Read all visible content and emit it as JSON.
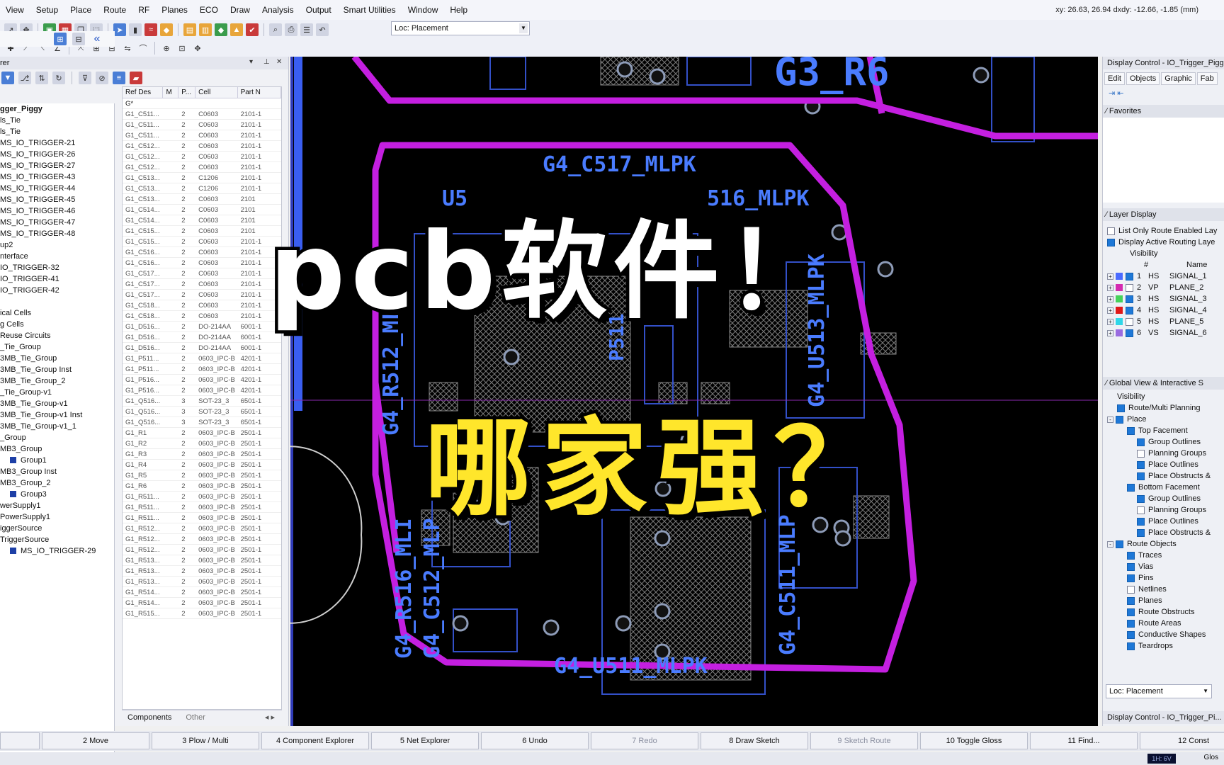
{
  "menu": [
    "View",
    "Setup",
    "Place",
    "Route",
    "RF",
    "Planes",
    "ECO",
    "Draw",
    "Analysis",
    "Output",
    "Smart Utilities",
    "Window",
    "Help"
  ],
  "coords": "xy: 26.63, 26.94  dxdy: -12.66, -1.85  (mm)",
  "toolbar": {
    "loc_label": "Loc: Placement"
  },
  "explorer": {
    "title": "rer",
    "tree": [
      {
        "label": "gger_Piggy",
        "bold": true,
        "icon": false
      },
      {
        "label": "ls_Tie",
        "icon": false
      },
      {
        "label": "ls_Tie",
        "icon": false
      },
      {
        "label": "MS_IO_TRIGGER-21",
        "icon": false
      },
      {
        "label": "MS_IO_TRIGGER-26",
        "icon": false
      },
      {
        "label": "MS_IO_TRIGGER-27",
        "icon": false
      },
      {
        "label": "MS_IO_TRIGGER-43",
        "icon": false
      },
      {
        "label": "MS_IO_TRIGGER-44",
        "icon": false
      },
      {
        "label": "MS_IO_TRIGGER-45",
        "icon": false
      },
      {
        "label": "MS_IO_TRIGGER-46",
        "icon": false
      },
      {
        "label": "MS_IO_TRIGGER-47",
        "icon": false
      },
      {
        "label": "MS_IO_TRIGGER-48",
        "icon": false
      },
      {
        "label": "up2",
        "icon": false
      },
      {
        "label": "nterface",
        "icon": false
      },
      {
        "label": "IO_TRIGGER-32",
        "icon": false
      },
      {
        "label": "IO_TRIGGER-41",
        "icon": false
      },
      {
        "label": "IO_TRIGGER-42",
        "icon": false
      },
      {
        "label": "",
        "icon": false
      },
      {
        "label": "ical Cells",
        "icon": false
      },
      {
        "label": "g Cells",
        "icon": false
      },
      {
        "label": "Reuse Circuits",
        "icon": false
      },
      {
        "label": "_Tie_Group",
        "icon": false
      },
      {
        "label": "3MB_Tie_Group",
        "icon": false
      },
      {
        "label": "3MB_Tie_Group Inst",
        "icon": false
      },
      {
        "label": "3MB_Tie_Group_2",
        "icon": false
      },
      {
        "label": "_Tie_Group-v1",
        "icon": false
      },
      {
        "label": "3MB_Tie_Group-v1",
        "icon": false
      },
      {
        "label": "3MB_Tie_Group-v1 Inst",
        "icon": false
      },
      {
        "label": "3MB_Tie_Group-v1_1",
        "icon": false
      },
      {
        "label": "_Group",
        "icon": false
      },
      {
        "label": "MB3_Group",
        "icon": false
      },
      {
        "label": "Group1",
        "icon": true
      },
      {
        "label": "MB3_Group Inst",
        "icon": false
      },
      {
        "label": "MB3_Group_2",
        "icon": false
      },
      {
        "label": "Group3",
        "icon": true
      },
      {
        "label": "werSupply1",
        "icon": false
      },
      {
        "label": "PowerSupply1",
        "icon": false
      },
      {
        "label": "iggerSource",
        "icon": false
      },
      {
        "label": "TriggerSource",
        "icon": false
      },
      {
        "label": "MS_IO_TRIGGER-29",
        "icon": true
      }
    ],
    "columns": [
      "Ref Des",
      "M",
      "P...",
      "Cell",
      "Part N"
    ],
    "filter": "G*",
    "rows": [
      [
        "G1_C511...",
        "",
        "2",
        "C0603",
        "2101-1"
      ],
      [
        "G1_C511...",
        "",
        "2",
        "C0603",
        "2101-1"
      ],
      [
        "G1_C511...",
        "",
        "2",
        "C0603",
        "2101-1"
      ],
      [
        "G1_C512...",
        "",
        "2",
        "C0603",
        "2101-1"
      ],
      [
        "G1_C512...",
        "",
        "2",
        "C0603",
        "2101-1"
      ],
      [
        "G1_C512...",
        "",
        "2",
        "C0603",
        "2101-1"
      ],
      [
        "G1_C513...",
        "",
        "2",
        "C1206",
        "2101-1"
      ],
      [
        "G1_C513...",
        "",
        "2",
        "C1206",
        "2101-1"
      ],
      [
        "G1_C513...",
        "",
        "2",
        "C0603",
        "2101"
      ],
      [
        "G1_C514...",
        "",
        "2",
        "C0603",
        "2101"
      ],
      [
        "G1_C514...",
        "",
        "2",
        "C0603",
        "2101"
      ],
      [
        "G1_C515...",
        "",
        "2",
        "C0603",
        "2101"
      ],
      [
        "G1_C515...",
        "",
        "2",
        "C0603",
        "2101-1"
      ],
      [
        "G1_C516...",
        "",
        "2",
        "C0603",
        "2101-1"
      ],
      [
        "G1_C516...",
        "",
        "2",
        "C0603",
        "2101-1"
      ],
      [
        "G1_C517...",
        "",
        "2",
        "C0603",
        "2101-1"
      ],
      [
        "G1_C517...",
        "",
        "2",
        "C0603",
        "2101-1"
      ],
      [
        "G1_C517...",
        "",
        "2",
        "C0603",
        "2101-1"
      ],
      [
        "G1_C518...",
        "",
        "2",
        "C0603",
        "2101-1"
      ],
      [
        "G1_C518...",
        "",
        "2",
        "C0603",
        "2101-1"
      ],
      [
        "G1_D516...",
        "",
        "2",
        "DO-214AA",
        "6001-1"
      ],
      [
        "G1_D516...",
        "",
        "2",
        "DO-214AA",
        "6001-1"
      ],
      [
        "G1_D516...",
        "",
        "2",
        "DO-214AA",
        "6001-1"
      ],
      [
        "G1_P511...",
        "",
        "2",
        "0603_IPC-B",
        "4201-1"
      ],
      [
        "G1_P511...",
        "",
        "2",
        "0603_IPC-B",
        "4201-1"
      ],
      [
        "G1_P516...",
        "",
        "2",
        "0603_IPC-B",
        "4201-1"
      ],
      [
        "G1_P516...",
        "",
        "2",
        "0603_IPC-B",
        "4201-1"
      ],
      [
        "G1_Q516...",
        "",
        "3",
        "SOT-23_3",
        "6501-1"
      ],
      [
        "G1_Q516...",
        "",
        "3",
        "SOT-23_3",
        "6501-1"
      ],
      [
        "G1_Q516...",
        "",
        "3",
        "SOT-23_3",
        "6501-1"
      ],
      [
        "G1_R1",
        "",
        "2",
        "0603_IPC-B",
        "2501-1"
      ],
      [
        "G1_R2",
        "",
        "2",
        "0603_IPC-B",
        "2501-1"
      ],
      [
        "G1_R3",
        "",
        "2",
        "0603_IPC-B",
        "2501-1"
      ],
      [
        "G1_R4",
        "",
        "2",
        "0603_IPC-B",
        "2501-1"
      ],
      [
        "G1_R5",
        "",
        "2",
        "0603_IPC-B",
        "2501-1"
      ],
      [
        "G1_R6",
        "",
        "2",
        "0603_IPC-B",
        "2501-1"
      ],
      [
        "G1_R511...",
        "",
        "2",
        "0603_IPC-B",
        "2501-1"
      ],
      [
        "G1_R511...",
        "",
        "2",
        "0603_IPC-B",
        "2501-1"
      ],
      [
        "G1_R511...",
        "",
        "2",
        "0603_IPC-B",
        "2501-1"
      ],
      [
        "G1_R512...",
        "",
        "2",
        "0603_IPC-B",
        "2501-1"
      ],
      [
        "G1_R512...",
        "",
        "2",
        "0603_IPC-B",
        "2501-1"
      ],
      [
        "G1_R512...",
        "",
        "2",
        "0603_IPC-B",
        "2501-1"
      ],
      [
        "G1_R513...",
        "",
        "2",
        "0603_IPC-B",
        "2501-1"
      ],
      [
        "G1_R513...",
        "",
        "2",
        "0603_IPC-B",
        "2501-1"
      ],
      [
        "G1_R513...",
        "",
        "2",
        "0603_IPC-B",
        "2501-1"
      ],
      [
        "G1_R514...",
        "",
        "2",
        "0603_IPC-B",
        "2501-1"
      ],
      [
        "G1_R514...",
        "",
        "2",
        "0603_IPC-B",
        "2501-1"
      ],
      [
        "G1_R515...",
        "",
        "2",
        "0603_IPC-B",
        "2501-1"
      ]
    ],
    "tabs": [
      "Components",
      "Other"
    ]
  },
  "canvas": {
    "labels": [
      "G3_R6",
      "G4_C517_MLPK",
      "U5",
      "516_MLPK",
      "G4_U513_MLPK",
      "G4_R512_MLF",
      "P511",
      "G4_R516_MLI",
      "G4_C512_MLP",
      "G4_C511_MLP",
      "G4_U511_MLPK"
    ]
  },
  "overlay": {
    "headline": "pcb软件！",
    "subline": "哪家强？"
  },
  "display": {
    "title": "Display Control - IO_Trigger_Pigg",
    "tabs": [
      "Edit",
      "Objects",
      "Graphic",
      "Fab"
    ],
    "favorites": "Favorites",
    "layer_display": "Layer Display",
    "layer_opts": [
      "List Only Route Enabled Lay",
      "Display Active Routing Laye"
    ],
    "layer_cols": [
      "Visibility",
      "#",
      "Name"
    ],
    "layers": [
      {
        "num": "1",
        "type": "HS",
        "name": "SIGNAL_1",
        "color": "#4a6bff"
      },
      {
        "num": "2",
        "type": "VP",
        "name": "PLANE_2",
        "color": "#d42ab0"
      },
      {
        "num": "3",
        "type": "HS",
        "name": "SIGNAL_3",
        "color": "#46d25a"
      },
      {
        "num": "4",
        "type": "HS",
        "name": "SIGNAL_4",
        "color": "#e01818"
      },
      {
        "num": "5",
        "type": "HS",
        "name": "PLANE_5",
        "color": "#2fd6e8"
      },
      {
        "num": "6",
        "type": "VS",
        "name": "SIGNAL_6",
        "color": "#9a6be0"
      }
    ],
    "global_view": "Global View & Interactive S",
    "visibility": "Visibility",
    "vis_items": [
      {
        "label": "Route/Multi Planning",
        "indent": 1,
        "checked": true,
        "exp": ""
      },
      {
        "label": "Place",
        "indent": 0,
        "checked": true,
        "exp": "-"
      },
      {
        "label": "Top Facement",
        "indent": 2,
        "checked": true,
        "exp": ""
      },
      {
        "label": "Group Outlines",
        "indent": 3,
        "checked": true,
        "exp": ""
      },
      {
        "label": "Planning Groups",
        "indent": 3,
        "checked": false,
        "exp": ""
      },
      {
        "label": "Place Outlines",
        "indent": 3,
        "checked": true,
        "exp": ""
      },
      {
        "label": "Place Obstructs &",
        "indent": 3,
        "checked": true,
        "exp": ""
      },
      {
        "label": "Bottom Facement",
        "indent": 2,
        "checked": true,
        "exp": ""
      },
      {
        "label": "Group Outlines",
        "indent": 3,
        "checked": true,
        "exp": ""
      },
      {
        "label": "Planning Groups",
        "indent": 3,
        "checked": false,
        "exp": ""
      },
      {
        "label": "Place Outlines",
        "indent": 3,
        "checked": true,
        "exp": ""
      },
      {
        "label": "Place Obstructs &",
        "indent": 3,
        "checked": true,
        "exp": ""
      },
      {
        "label": "Route Objects",
        "indent": 0,
        "checked": true,
        "exp": "-"
      },
      {
        "label": "Traces",
        "indent": 2,
        "checked": true,
        "exp": ""
      },
      {
        "label": "Vias",
        "indent": 2,
        "checked": true,
        "exp": ""
      },
      {
        "label": "Pins",
        "indent": 2,
        "checked": true,
        "exp": ""
      },
      {
        "label": "Netlines",
        "indent": 2,
        "checked": false,
        "exp": ""
      },
      {
        "label": "Planes",
        "indent": 2,
        "checked": true,
        "exp": ""
      },
      {
        "label": "Route Obstructs",
        "indent": 2,
        "checked": true,
        "exp": ""
      },
      {
        "label": "Route Areas",
        "indent": 2,
        "checked": true,
        "exp": ""
      },
      {
        "label": "Conductive Shapes",
        "indent": 2,
        "checked": true,
        "exp": ""
      },
      {
        "label": "Teardrops",
        "indent": 2,
        "checked": true,
        "exp": ""
      }
    ],
    "loc": "Loc: Placement",
    "footer": "Display Control - IO_Trigger_Pi..."
  },
  "fkeys": [
    {
      "label": "",
      "dim": false
    },
    {
      "label": "2 Move",
      "dim": false
    },
    {
      "label": "3 Plow / Multi",
      "dim": false
    },
    {
      "label": "4 Component Explorer",
      "dim": false
    },
    {
      "label": "5 Net Explorer",
      "dim": false
    },
    {
      "label": "6 Undo",
      "dim": false
    },
    {
      "label": "7 Redo",
      "dim": true
    },
    {
      "label": "8 Draw Sketch",
      "dim": false
    },
    {
      "label": "9 Sketch Route",
      "dim": true
    },
    {
      "label": "10 Toggle Gloss",
      "dim": false
    },
    {
      "label": "11 Find...",
      "dim": false
    },
    {
      "label": "12 Const",
      "dim": false
    }
  ],
  "status": {
    "chip": "1H: 6V",
    "gloss": "Glos"
  }
}
